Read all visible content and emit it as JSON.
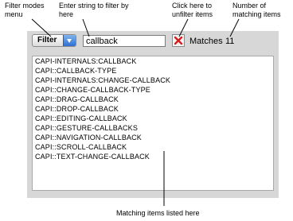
{
  "annotations": {
    "filter_modes": "Filter modes menu",
    "enter_string": "Enter string to filter by here",
    "click_here": "Click here to unfilter items",
    "number_matching": "Number of matching items",
    "matching_listed": "Matching items listed here"
  },
  "toolbar": {
    "filter_label": "Filter",
    "filter_icon": "chevron-down-icon",
    "search_value": "callback",
    "clear_icon": "close-icon",
    "matches_label": "Matches",
    "matches_count": "11"
  },
  "list": {
    "items": [
      "CAPI-INTERNALS:CALLBACK",
      "CAPI::CALLBACK-TYPE",
      "CAPI-INTERNALS:CHANGE-CALLBACK",
      "CAPI::CHANGE-CALLBACK-TYPE",
      "CAPI::DRAG-CALLBACK",
      "CAPI::DROP-CALLBACK",
      "CAPI::EDITING-CALLBACK",
      "CAPI::GESTURE-CALLBACKS",
      "CAPI::NAVIGATION-CALLBACK",
      "CAPI::SCROLL-CALLBACK",
      "CAPI::TEXT-CHANGE-CALLBACK"
    ]
  },
  "colors": {
    "panel": "#d7d7d7",
    "dropdown_accent": "#2f6fd0",
    "clear_x": "#d81c1c"
  }
}
